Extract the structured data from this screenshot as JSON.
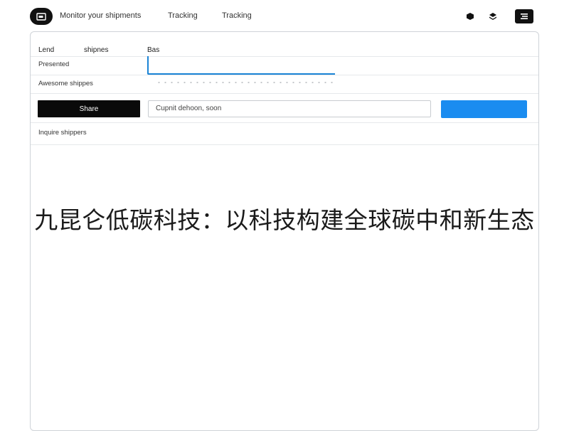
{
  "header": {
    "nav": [
      {
        "label": "Monitor your shipments"
      },
      {
        "label": "Tracking"
      },
      {
        "label": "Tracking"
      }
    ],
    "icons": [
      "box-icon",
      "layers-icon",
      "menu-icon"
    ]
  },
  "panel": {
    "tabs": [
      {
        "label": "Lend"
      },
      {
        "label": "shipnes"
      },
      {
        "label": "Bas"
      }
    ],
    "rows": {
      "row1_label": "Presented",
      "row2_label": "Awesome shippes",
      "row4_label": "Inquire shippers"
    },
    "primary_button": "Share",
    "input_value": "Cupnit dehoon, soon"
  },
  "overlay": {
    "caption": "九昆仑低碳科技：以科技构建全球碳中和新生态"
  },
  "colors": {
    "accent": "#1a8cf0",
    "dark": "#0a0a0a",
    "border": "#cfd3d8"
  }
}
